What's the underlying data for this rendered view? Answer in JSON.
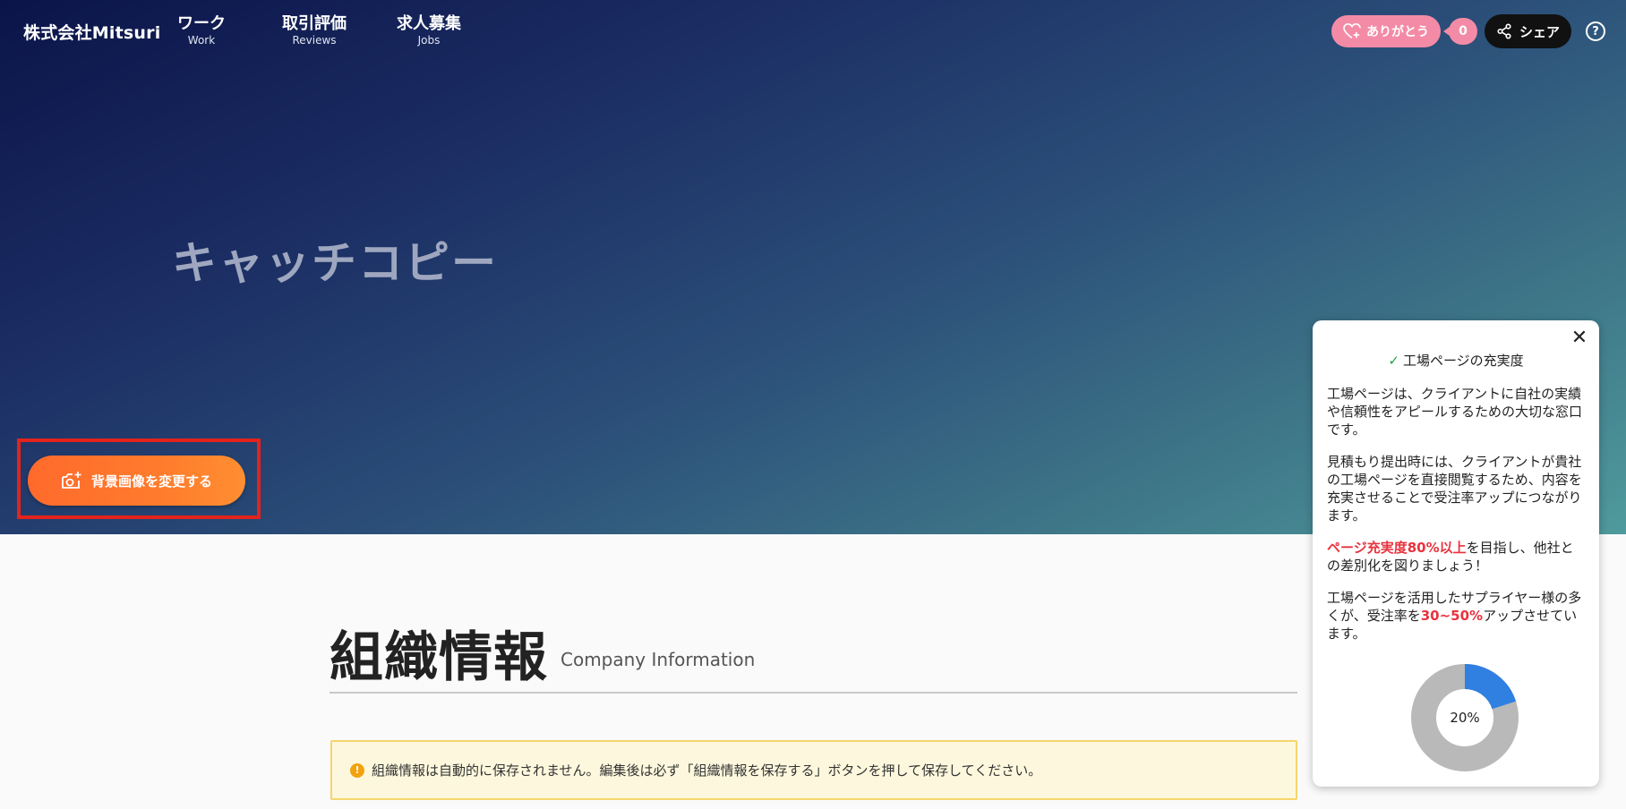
{
  "header": {
    "brand": "株式会社Mitsuri",
    "nav": [
      {
        "jp": "ワーク",
        "en": "Work"
      },
      {
        "jp": "取引評価",
        "en": "Reviews"
      },
      {
        "jp": "求人募集",
        "en": "Jobs"
      }
    ],
    "thanks_label": "ありがとう",
    "thanks_count": "0",
    "share_label": "シェア",
    "help_label": "?"
  },
  "hero": {
    "catchcopy": "キャッチコピー",
    "change_bg_label": "背景画像を変更する"
  },
  "section": {
    "title": "組織情報",
    "subtitle": "Company Information",
    "notice": "組織情報は自動的に保存されません。編集後は必ず「組織情報を保存する」ボタンを押して保存してください。"
  },
  "panel": {
    "title": "工場ページの充実度",
    "p1": "工場ページは、クライアントに自社の実績や信頼性をアピールするための大切な窓口です。",
    "p2": "見積もり提出時には、クライアントが貴社の工場ページを直接閲覧するため、内容を充実させることで受注率アップにつながります。",
    "p3_hl": "ページ充実度80%以上",
    "p3_rest": "を目指し、他社との差別化を図りましょう！",
    "p4_a": "工場ページを活用したサプライヤー様の多くが、受注率を",
    "p4_hl": "30~50%",
    "p4_b": "アップさせています。",
    "progress_label": "20%",
    "progress_value": 0.2,
    "progress_color": "#2f80e0",
    "track_color": "#b9b9b9"
  },
  "colors": {
    "accent_orange": "#ff7a2c",
    "thanks_pink": "#f48ba6",
    "highlight_red": "#e8333e"
  }
}
